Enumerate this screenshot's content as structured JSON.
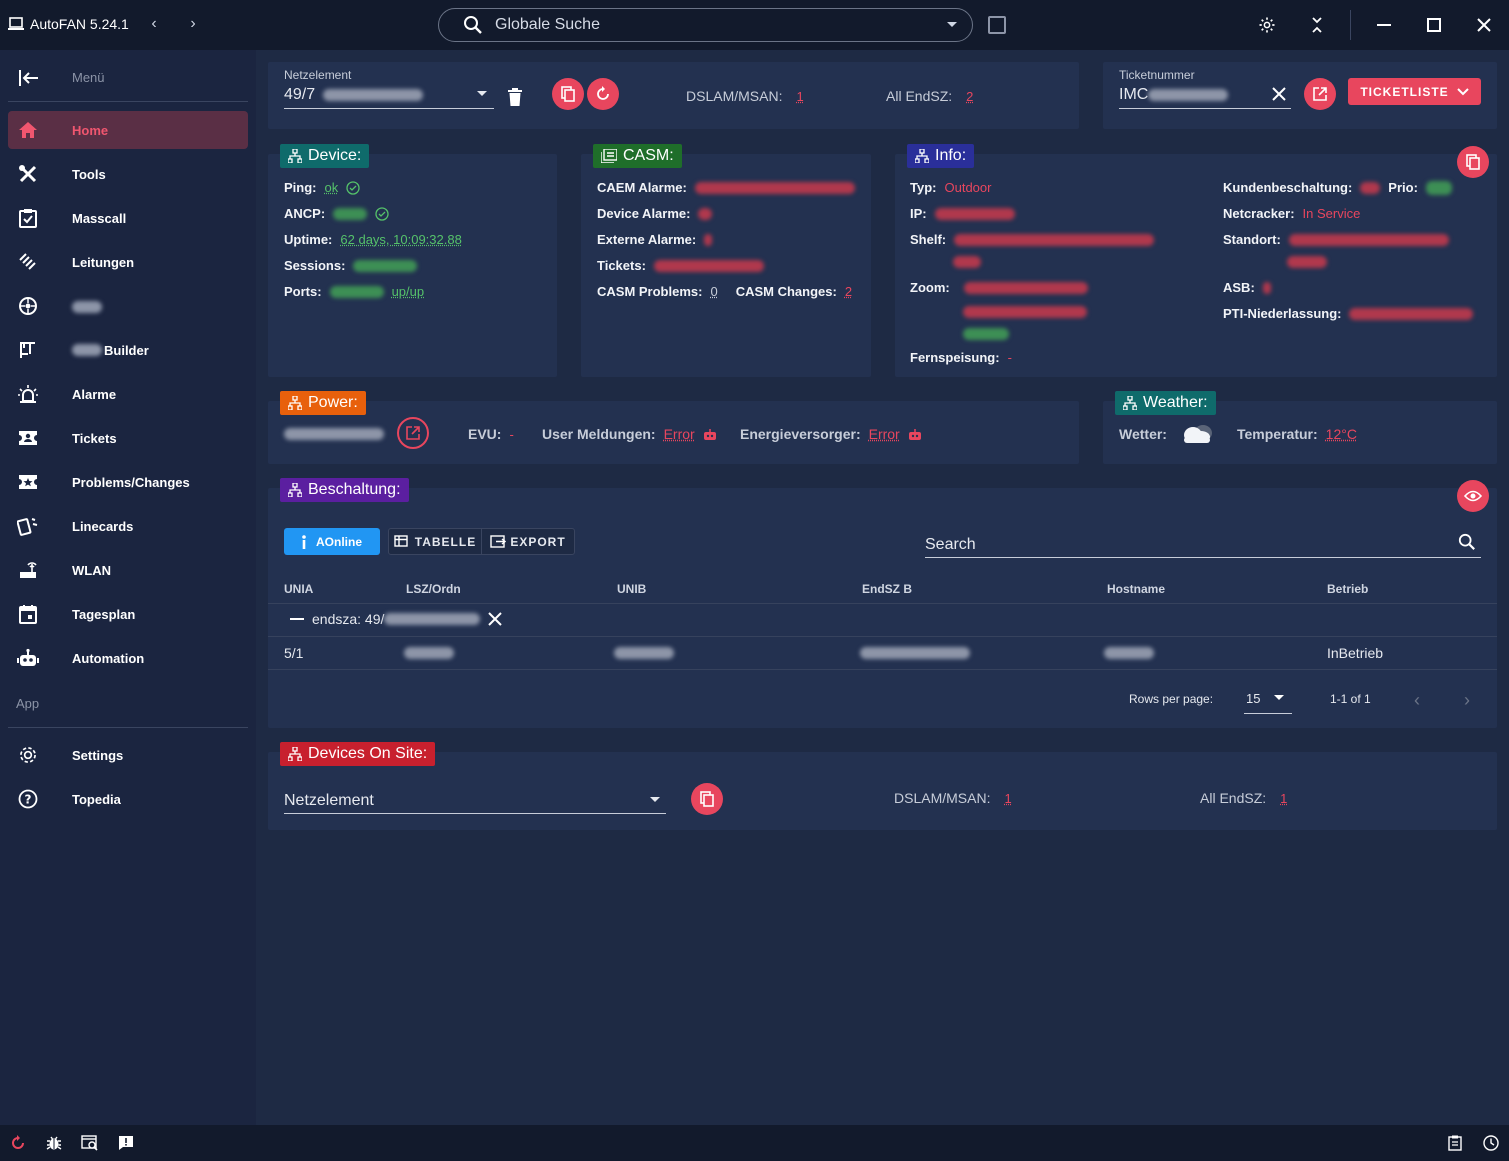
{
  "app": {
    "title": "AutoFAN 5.24.1"
  },
  "search": {
    "placeholder": "Globale Suche"
  },
  "sidebar": {
    "menu_label": "Menü",
    "items": [
      {
        "label": "Home",
        "icon": "home-icon"
      },
      {
        "label": "Tools",
        "icon": "tools-icon"
      },
      {
        "label": "Masscall",
        "icon": "clipboard-check-icon"
      },
      {
        "label": "Leitungen",
        "icon": "cable-icon"
      },
      {
        "label": "",
        "icon": "network-circle-icon"
      },
      {
        "label": "Builder",
        "icon": "builder-icon"
      },
      {
        "label": "Alarme",
        "icon": "alarm-light-icon"
      },
      {
        "label": "Tickets",
        "icon": "ticket-icon"
      },
      {
        "label": "Problems/Changes",
        "icon": "ticket-star-icon"
      },
      {
        "label": "Linecards",
        "icon": "cards-icon"
      },
      {
        "label": "WLAN",
        "icon": "router-icon"
      },
      {
        "label": "Tagesplan",
        "icon": "calendar-icon"
      },
      {
        "label": "Automation",
        "icon": "robot-icon"
      }
    ],
    "app_label": "App",
    "bottom_items": [
      {
        "label": "Settings",
        "icon": "gear-icon"
      },
      {
        "label": "Topedia",
        "icon": "help-circle-icon"
      }
    ]
  },
  "netzelement": {
    "label": "Netzelement",
    "value": "49/7",
    "dslam_label": "DSLAM/MSAN:",
    "dslam_value": "1",
    "endsz_label": "All EndSZ:",
    "endsz_value": "2"
  },
  "ticket": {
    "label": "Ticketnummer",
    "value": "IMC",
    "list_button": "TICKETLISTE"
  },
  "device": {
    "title": "Device:",
    "ping_label": "Ping:",
    "ping_value": "ok",
    "ancp_label": "ANCP:",
    "uptime_label": "Uptime:",
    "uptime_value": "62 days, 10:09:32.88",
    "sessions_label": "Sessions:",
    "ports_label": "Ports:",
    "ports_value": "up/up"
  },
  "casm": {
    "title": "CASM:",
    "caem_label": "CAEM Alarme:",
    "device_alarm_label": "Device Alarme:",
    "extern_label": "Externe Alarme:",
    "tickets_label": "Tickets:",
    "problems_label": "CASM Problems:",
    "problems_value": "0",
    "changes_label": "CASM Changes:",
    "changes_value": "2"
  },
  "info": {
    "title": "Info:",
    "typ_label": "Typ:",
    "typ_value": "Outdoor",
    "ip_label": "IP:",
    "shelf_label": "Shelf:",
    "zoom_label": "Zoom:",
    "fern_label": "Fernspeisung:",
    "fern_value": "-",
    "kunden_label": "Kundenbeschaltung:",
    "prio_label": "Prio:",
    "netcracker_label": "Netcracker:",
    "netcracker_value": "In Service",
    "standort_label": "Standort:",
    "asb_label": "ASB:",
    "pti_label": "PTI-Niederlassung:"
  },
  "power": {
    "title": "Power:",
    "evu_label": "EVU:",
    "evu_value": "-",
    "user_label": "User Meldungen:",
    "user_value": "Error",
    "energie_label": "Energieversorger:",
    "energie_value": "Error"
  },
  "weather": {
    "title": "Weather:",
    "wetter_label": "Wetter:",
    "temp_label": "Temperatur:",
    "temp_value": "12°C"
  },
  "beschaltung": {
    "title": "Beschaltung:",
    "btn_aonline": "AOnline",
    "btn_tabelle": "TABELLE",
    "btn_export": "EXPORT",
    "search_placeholder": "Search",
    "columns": [
      "UNIA",
      "LSZ/Ordn",
      "UNIB",
      "EndSZ B",
      "Hostname",
      "Betrieb"
    ],
    "group_label": "endsza: 49/",
    "row": {
      "unia": "5/1",
      "betrieb": "InBetrieb"
    },
    "rows_per_page_label": "Rows per page:",
    "rows_per_page_value": "15",
    "page_info": "1-1 of 1"
  },
  "devices_on_site": {
    "title": "Devices On Site:",
    "netzelement_placeholder": "Netzelement",
    "dslam_label": "DSLAM/MSAN:",
    "dslam_value": "1",
    "endsz_label": "All EndSZ:",
    "endsz_value": "1"
  },
  "colors": {
    "accent": "#e8465e",
    "device_title": "#0f6b6b",
    "casm_title": "#1f6e2a",
    "info_title": "#2a2f9a",
    "power_title": "#e8600c",
    "weather_title": "#0f6b6b",
    "beschaltung_title": "#5b1fa0",
    "devices_on_site_title": "#c8202e"
  }
}
